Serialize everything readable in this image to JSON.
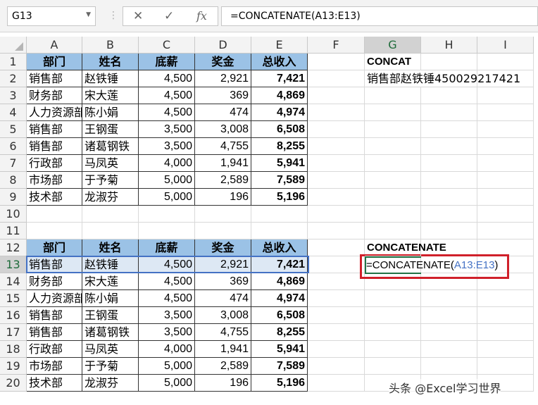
{
  "name_box": "G13",
  "formula_bar": {
    "cancel_icon": "✕",
    "enter_icon": "✓",
    "fx_icon": "fx",
    "formula": "=CONCATENATE(A13:E13)"
  },
  "columns": [
    "A",
    "B",
    "C",
    "D",
    "E",
    "F",
    "G",
    "H",
    "I"
  ],
  "headers": [
    "部门",
    "姓名",
    "底薪",
    "奖金",
    "总收入"
  ],
  "records": [
    [
      "销售部",
      "赵铁锤",
      "4,500",
      "2,921",
      "7,421"
    ],
    [
      "财务部",
      "宋大莲",
      "4,500",
      "369",
      "4,869"
    ],
    [
      "人力资源部",
      "陈小娟",
      "4,500",
      "474",
      "4,974"
    ],
    [
      "销售部",
      "王钢蛋",
      "3,500",
      "3,008",
      "6,508"
    ],
    [
      "销售部",
      "诸葛钢铁",
      "3,500",
      "4,755",
      "8,255"
    ],
    [
      "行政部",
      "马凤英",
      "4,000",
      "1,941",
      "5,941"
    ],
    [
      "市场部",
      "于予菊",
      "5,000",
      "2,589",
      "7,589"
    ],
    [
      "技术部",
      "龙淑芬",
      "5,000",
      "196",
      "5,196"
    ]
  ],
  "concat_label": "CONCAT",
  "concat_result": "销售部赵铁锤450029217421",
  "concatenate_label": "CONCATENATE",
  "edit_formula": {
    "prefix": "=CONCATENATE(",
    "range": "A13:E13",
    "suffix": ")"
  },
  "watermark": "头条 @Excel学习世界"
}
